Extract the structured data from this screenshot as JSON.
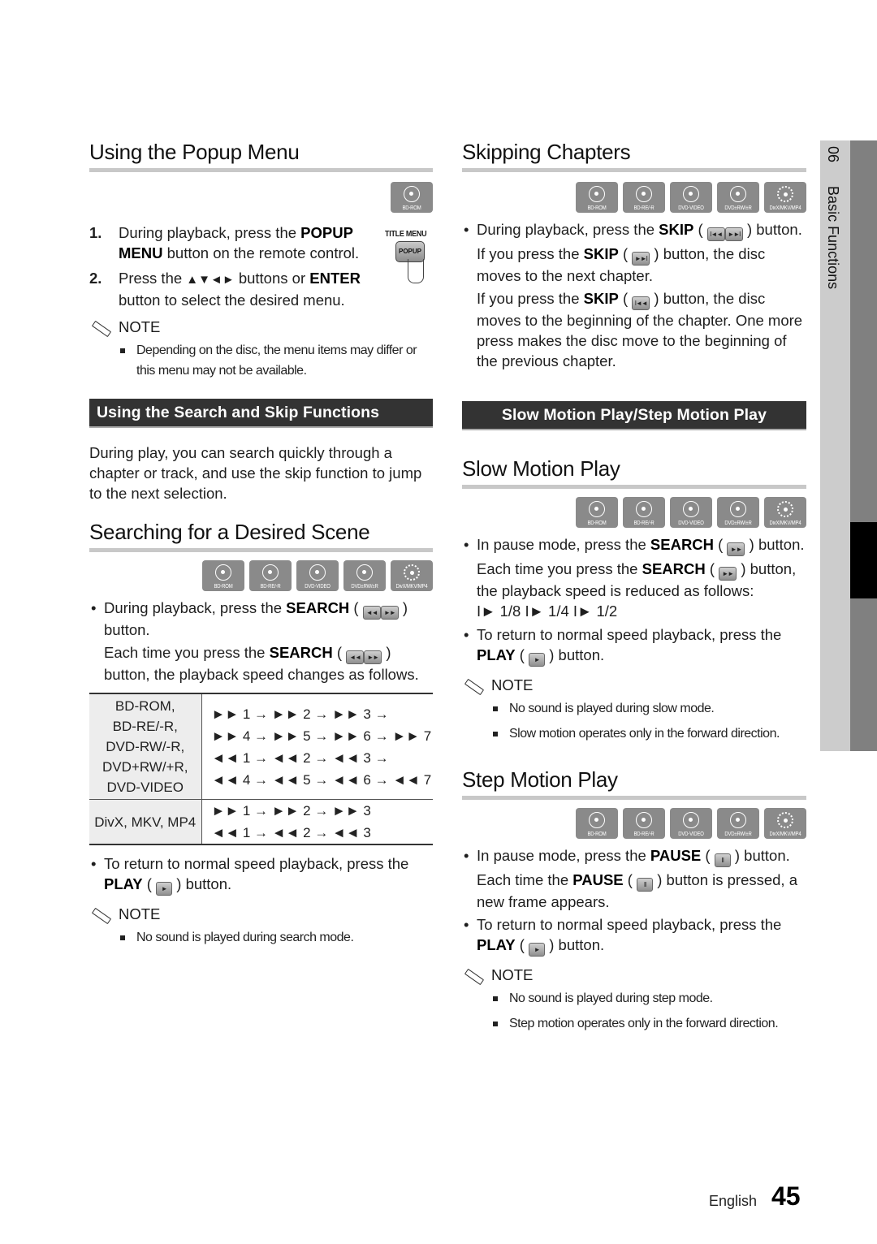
{
  "left": {
    "popup_title": "Using the Popup Menu",
    "popup_badge": "BD-ROM",
    "popup_figure": {
      "title_menu": "TITLE MENU",
      "popup": "POPUP"
    },
    "steps": [
      {
        "num": "1.",
        "pre": "During playback, press the ",
        "bold1": "POPUP",
        "br": "",
        "bold2": "MENU",
        "post": " button on the remote control."
      },
      {
        "num": "2.",
        "pre": "Press the ",
        "arrows": "▲▼◄►",
        "mid": " buttons or ",
        "bold": "ENTER",
        "post": " button to select the desired menu."
      }
    ],
    "note1_label": "NOTE",
    "note1_items": [
      "Depending on the disc, the menu items may differ or this menu may not be available."
    ],
    "bar1": "Using the Search and Skip Functions",
    "intro": "During play, you can search quickly through a chapter or track, and use the skip function to jump to the next selection.",
    "search_title": "Searching for a Desired Scene",
    "search_b1_pre": "During playback, press the ",
    "search_b1_bold": "SEARCH",
    "search_b1_post": "button.",
    "search_b2_pre": "Each time you press the ",
    "search_b2_bold": "SEARCH",
    "search_b2_post": "button, the playback speed changes as follows.",
    "table": [
      {
        "formats": [
          "BD-ROM,",
          "BD-RE/-R,",
          "DVD-RW/-R,",
          "DVD+RW/+R,",
          "DVD-VIDEO"
        ],
        "sequences": [
          "►► 1 → ►► 2 → ►► 3 →",
          "►► 4 → ►► 5 → ►► 6 → ►► 7",
          "◄◄ 1 → ◄◄ 2 → ◄◄ 3 →",
          "◄◄ 4 → ◄◄ 5 → ◄◄ 6 → ◄◄ 7"
        ]
      },
      {
        "formats": [
          "DivX, MKV, MP4"
        ],
        "sequences": [
          "►► 1 → ►► 2 → ►► 3",
          "◄◄ 1 → ◄◄ 2 → ◄◄ 3"
        ]
      }
    ],
    "return_pre": "To return to normal speed playback, press the ",
    "return_bold": "PLAY",
    "return_post": "button.",
    "note2_label": "NOTE",
    "note2_items": [
      "No sound is played during search mode."
    ]
  },
  "right": {
    "skip_title": "Skipping Chapters",
    "skip_b1_pre": "During playback, press the ",
    "skip_b1_bold": "SKIP",
    "skip_b1_post": "button.",
    "skip_p2_pre": "If you press the ",
    "skip_p2_bold": "SKIP",
    "skip_p2_post": " button, the disc moves to the next chapter.",
    "skip_p3_pre": "If you press the ",
    "skip_p3_bold": "SKIP",
    "skip_p3_post": " button, the disc moves to the beginning of the chapter. One more press makes the disc move to the beginning of the previous chapter.",
    "bar2": "Slow Motion Play/Step Motion Play",
    "slow_title": "Slow Motion Play",
    "slow_b1_pre": "In pause mode, press the ",
    "slow_b1_bold": "SEARCH",
    "slow_b1_post": "button.",
    "slow_p2_pre": "Each time you press the ",
    "slow_p2_bold": "SEARCH",
    "slow_p2_post": " button, the playback speed is reduced as follows:",
    "slow_speeds": "I► 1/8 I► 1/4 I► 1/2",
    "slow_return_pre": "To return to normal speed playback, press the ",
    "slow_return_bold": "PLAY",
    "slow_return_post": " button.",
    "note3_label": "NOTE",
    "note3_items": [
      "No sound is played during slow mode.",
      "Slow motion operates only in the forward direction."
    ],
    "step_title": "Step Motion Play",
    "step_b1_pre": "In pause mode, press the ",
    "step_b1_bold": "PAUSE",
    "step_b1_post": " button.",
    "step_p2_pre": "Each time the ",
    "step_p2_bold": "PAUSE",
    "step_p2_post": " button is pressed, a new frame appears.",
    "step_return_pre": "To return to normal speed playback, press the ",
    "step_return_bold": "PLAY",
    "step_return_post": " button.",
    "note4_label": "NOTE",
    "note4_items": [
      "No sound is played during step mode.",
      "Step motion operates only in the forward direction."
    ]
  },
  "badges": [
    "BD-ROM",
    "BD-RE/-R",
    "DVD-VIDEO",
    "DVD±RW/±R",
    "DivX/MKV/MP4"
  ],
  "keys": {
    "rew": "◄◄",
    "ff": "►►",
    "prev": "I◄◄",
    "next": "►►I",
    "play": "►",
    "pause": "II"
  },
  "sidebar": {
    "chapter_num": "06",
    "chapter_title": "Basic Functions"
  },
  "footer": {
    "language": "English",
    "page": "45"
  }
}
